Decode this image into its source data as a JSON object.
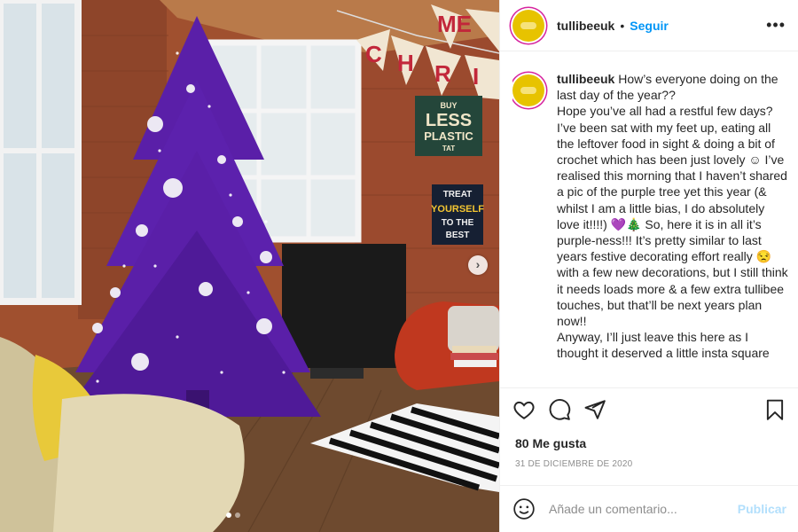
{
  "post": {
    "username": "tullibeeuk",
    "separator": "•",
    "follow_label": "Seguir",
    "more_label": "•••",
    "caption_username": "tullibeeuk",
    "caption_text": " How’s everyone doing on the last day of the year??\nHope you’ve all had a restful few days? I’ve been sat with my feet up, eating all the leftover food in sight & doing a bit of crochet which has been just lovely ☺ I’ve realised this morning that I haven’t shared a pic of the purple tree yet this year (& whilst I am a little bias, I do absolutely love it!!!!) 💜🎄 So, here it is in all it’s purple-ness!!! It’s pretty similar to last years festive decorating effort really 😒 with a few new decorations, but I still think it needs loads more & a few extra tullibee touches, but that’ll be next years plan now!!\nAnyway, I’ll just leave this here as I thought it deserved a little insta square",
    "likes": "80 Me gusta",
    "date": "31 DE DICIEMBRE DE 2020",
    "comment_placeholder": "Añade un comentario...",
    "post_label": "Publicar"
  },
  "photo": {
    "bunting_letters": [
      "ME",
      "C",
      "H",
      "R",
      "I"
    ],
    "sign_plastic": [
      "BUY",
      "LESS",
      "PLASTIC",
      "TAT"
    ],
    "sign_treat": [
      "TREAT",
      "YOURSELF",
      "TO THE",
      "BEST"
    ],
    "next_arrow": "›",
    "tree_color": "#5a1fa8",
    "wall_color": "#9b4a2e"
  },
  "colors": {
    "follow": "#0095f6",
    "publish": "#b2dffc",
    "avatar": "#e7c300"
  }
}
